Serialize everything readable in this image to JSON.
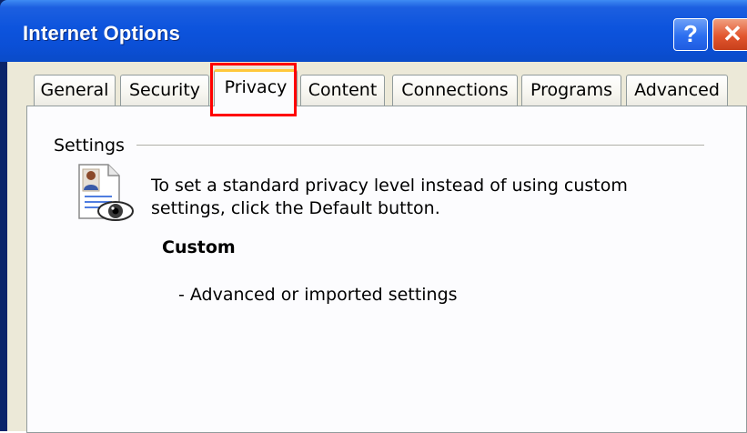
{
  "window": {
    "title": "Internet Options",
    "help_label": "?",
    "close_label": "✕"
  },
  "tabs": [
    {
      "label": "General"
    },
    {
      "label": "Security"
    },
    {
      "label": "Privacy",
      "selected": true
    },
    {
      "label": "Content"
    },
    {
      "label": "Connections"
    },
    {
      "label": "Programs"
    },
    {
      "label": "Advanced"
    }
  ],
  "settings": {
    "group_label": "Settings",
    "icon": "privacy-document-eye-icon",
    "description": "To set a standard privacy level instead of using custom settings, click the Default button.",
    "level_name": "Custom",
    "level_detail": "- Advanced or imported settings"
  },
  "colors": {
    "titlebar": "#0b4fd6",
    "dialog_bg": "#ece9d8",
    "tab_active_accent": "#ffc83c",
    "highlight_outline": "#ff0000",
    "close_button": "#e2562f"
  }
}
